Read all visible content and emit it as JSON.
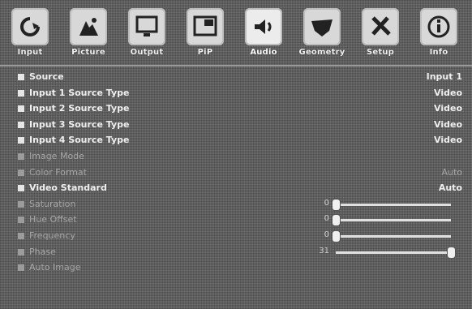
{
  "tabs": [
    {
      "label": "Input",
      "icon": "input-icon",
      "active": false
    },
    {
      "label": "Picture",
      "icon": "picture-icon",
      "active": false
    },
    {
      "label": "Output",
      "icon": "output-icon",
      "active": false
    },
    {
      "label": "PiP",
      "icon": "pip-icon",
      "active": false
    },
    {
      "label": "Audio",
      "icon": "audio-icon",
      "active": true
    },
    {
      "label": "Geometry",
      "icon": "geometry-icon",
      "active": false
    },
    {
      "label": "Setup",
      "icon": "setup-icon",
      "active": false
    },
    {
      "label": "Info",
      "icon": "info-icon",
      "active": false
    }
  ],
  "rows": [
    {
      "label": "Source",
      "value": "Input 1",
      "enabled": true
    },
    {
      "label": "Input 1 Source Type",
      "value": "Video",
      "enabled": true
    },
    {
      "label": "Input 2 Source Type",
      "value": "Video",
      "enabled": true
    },
    {
      "label": "Input 3 Source Type",
      "value": "Video",
      "enabled": true
    },
    {
      "label": "Input 4 Source Type",
      "value": "Video",
      "enabled": true
    },
    {
      "label": "Image Mode",
      "value": "",
      "enabled": false
    },
    {
      "label": "Color Format",
      "value": "Auto",
      "enabled": false
    },
    {
      "label": "Video Standard",
      "value": "Auto",
      "enabled": true
    },
    {
      "label": "Saturation",
      "num": "0",
      "level": 0.0,
      "enabled": false
    },
    {
      "label": "Hue Offset",
      "num": "0",
      "level": 0.0,
      "enabled": false
    },
    {
      "label": "Frequency",
      "num": "0",
      "level": 0.0,
      "enabled": false
    },
    {
      "label": "Phase",
      "num": "31",
      "level": 1.0,
      "enabled": false
    },
    {
      "label": "Auto Image",
      "value": "",
      "enabled": false
    }
  ]
}
